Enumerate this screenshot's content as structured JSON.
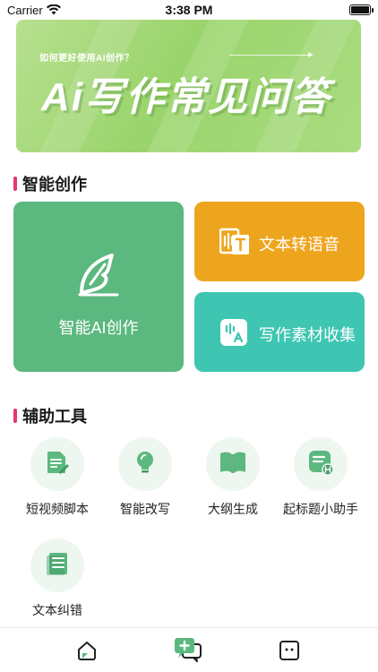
{
  "status_bar": {
    "carrier": "Carrier",
    "time": "3:38 PM"
  },
  "banner": {
    "subtitle": "如何更好使用Ai创作？",
    "title": "Ai写作常见问答"
  },
  "sections": {
    "smart_creation": "智能创作",
    "assist_tools": "辅助工具"
  },
  "cards": {
    "ai_creation": {
      "label": "智能AI创作",
      "color": "#5bb87e"
    },
    "text_to_speech": {
      "label": "文本转语音",
      "color": "#eea51e"
    },
    "material_collect": {
      "label": "写作素材收集",
      "color": "#3ec6b2"
    }
  },
  "tools": [
    {
      "label": "短视频脚本",
      "icon": "script-document-icon"
    },
    {
      "label": "智能改写",
      "icon": "lightbulb-icon"
    },
    {
      "label": "大纲生成",
      "icon": "book-icon"
    },
    {
      "label": "起标题小助手",
      "icon": "title-helper-icon"
    },
    {
      "label": "文本纠错",
      "icon": "notebook-icon"
    }
  ],
  "tabbar": [
    {
      "icon": "home-icon"
    },
    {
      "icon": "chat-add-icon"
    },
    {
      "icon": "profile-icon"
    }
  ],
  "colors": {
    "accent": "#e8366b",
    "tool_icon": "#5bb87e",
    "tool_bg": "#eef6f0"
  }
}
